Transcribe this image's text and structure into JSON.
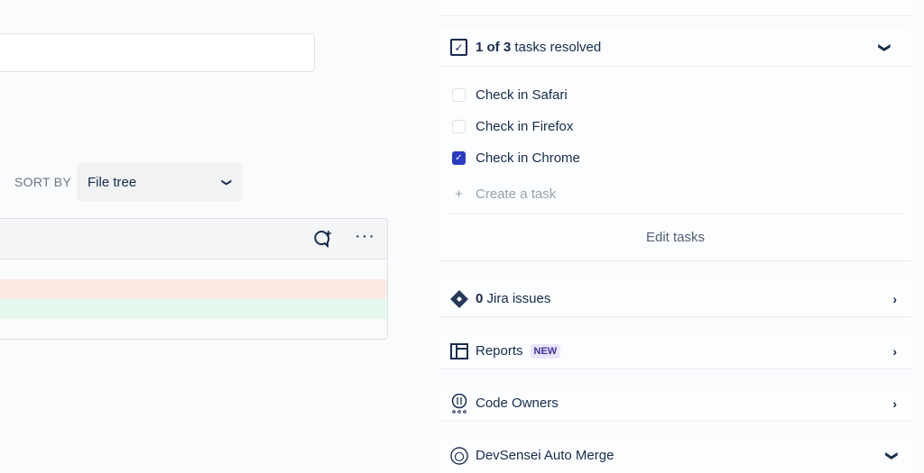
{
  "sort": {
    "label": "SORT BY",
    "value": "File tree"
  },
  "tasks": {
    "count_bold": "1 of 3",
    "count_rest": " tasks resolved",
    "items": [
      {
        "label": "Check in Safari",
        "checked": false
      },
      {
        "label": "Check in Firefox",
        "checked": false
      },
      {
        "label": "Check in Chrome",
        "checked": true
      }
    ],
    "create": "Create a task",
    "edit": "Edit tasks"
  },
  "jira": {
    "count": "0",
    "label": " Jira issues"
  },
  "reports": {
    "label": "Reports",
    "badge": "NEW"
  },
  "code_owners": {
    "label": "Code Owners"
  },
  "devsensei": {
    "label": "DevSensei Auto Merge"
  },
  "colors": {
    "accent": "#2b3bc0",
    "removed": "#fdeae4",
    "added": "#e5f8ee"
  }
}
